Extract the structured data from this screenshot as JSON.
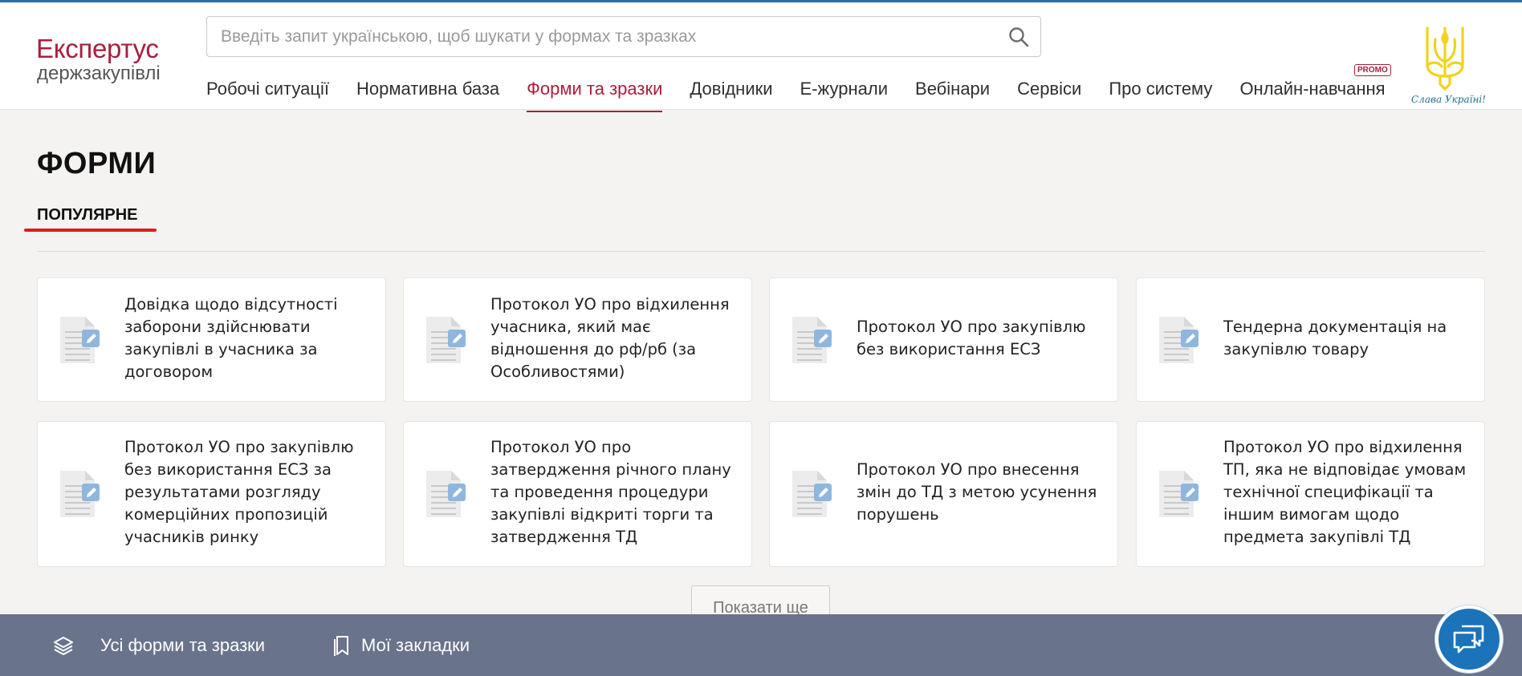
{
  "logo": {
    "title": "Експертус",
    "subtitle": "держзакупівлі"
  },
  "search": {
    "placeholder": "Введіть запит українською, щоб шукати у формах та зразках",
    "icon": "search-icon"
  },
  "nav": {
    "items": [
      {
        "label": "Робочі ситуації",
        "active": false
      },
      {
        "label": "Нормативна база",
        "active": false
      },
      {
        "label": "Форми та зразки",
        "active": true
      },
      {
        "label": "Довідники",
        "active": false
      },
      {
        "label": "Е-журнали",
        "active": false
      },
      {
        "label": "Вебінари",
        "active": false
      },
      {
        "label": "Сервіси",
        "active": false
      },
      {
        "label": "Про систему",
        "active": false
      },
      {
        "label": "Онлайн-навчання",
        "active": false
      }
    ],
    "promo_badge": "PROMO"
  },
  "emblem": {
    "caption": "Слава Україні!"
  },
  "page": {
    "title": "ФОРМИ",
    "section_tab": "ПОПУЛЯРНЕ"
  },
  "cards": [
    {
      "title": "Довідка щодо відсутності заборони здійснювати закупівлі в учасника за договором",
      "icon": "document-edit-icon"
    },
    {
      "title": "Протокол УО про відхилення учасника, який має відношення до рф/рб (за Особливостями)",
      "icon": "document-edit-icon"
    },
    {
      "title": "Протокол УО про закупівлю без використання ЕСЗ",
      "icon": "document-edit-icon"
    },
    {
      "title": "Тендерна документація на закупівлю товару",
      "icon": "document-edit-icon"
    },
    {
      "title": "Протокол УО про закупівлю без використання ЕСЗ за результатами розгляду комерційних пропозицій учасників ринку",
      "icon": "document-edit-icon"
    },
    {
      "title": "Протокол УО про затвердження річного плану та проведення процедури закупівлі відкриті торги та затвердження ТД",
      "icon": "document-edit-icon"
    },
    {
      "title": "Протокол УО про внесення змін до ТД з метою усунення порушень",
      "icon": "document-edit-icon"
    },
    {
      "title": "Протокол УО про відхилення ТП, яка не відповідає умовам технічної специфікації та іншим вимогам щодо предмета закупівлі ТД",
      "icon": "document-edit-icon"
    }
  ],
  "show_more": "Показати ще",
  "bottom_bar": {
    "all_forms": {
      "label": "Усі форми та зразки",
      "icon": "layers-icon"
    },
    "bookmarks": {
      "label": "Мої закладки",
      "icon": "bookmark-icon"
    }
  },
  "chat": {
    "icon": "chat-icon"
  },
  "colors": {
    "brand": "#a8203c",
    "bottom_bar": "#6a738c",
    "chat": "#1b73b9",
    "underline": "#e3191b"
  }
}
